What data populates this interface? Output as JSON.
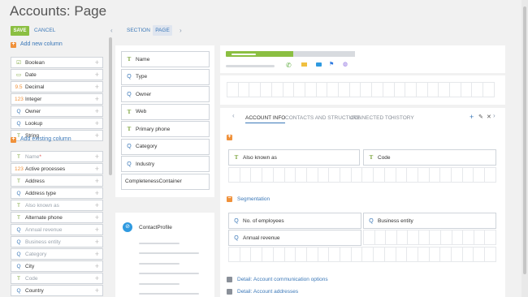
{
  "page": {
    "title": "Accounts: Page"
  },
  "toolbar": {
    "save_label": "SAVE",
    "cancel_label": "CANCEL"
  },
  "designer_tabs": {
    "section_label": "SECTION",
    "page_label": "PAGE"
  },
  "left": {
    "add_new_column_label": "Add new column",
    "new_columns": [
      {
        "icon": "☑",
        "label": "Boolean"
      },
      {
        "icon": "▭",
        "label": "Date"
      },
      {
        "icon": "9.5",
        "label": "Decimal"
      },
      {
        "icon": "123",
        "label": "Integer"
      },
      {
        "icon": "Q",
        "label": "Owner"
      },
      {
        "icon": "Q",
        "label": "Lookup"
      },
      {
        "icon": "T",
        "label": "String"
      }
    ],
    "add_existing_column_label": "Add existing column",
    "existing_columns": [
      {
        "icon": "T",
        "label": "Name",
        "required": "*"
      },
      {
        "icon": "123",
        "label": "Active processes"
      },
      {
        "icon": "T",
        "label": "Address"
      },
      {
        "icon": "Q",
        "label": "Address type"
      },
      {
        "icon": "T",
        "label": "Also known as"
      },
      {
        "icon": "T",
        "label": "Alternate phone"
      },
      {
        "icon": "Q",
        "label": "Annual revenue"
      },
      {
        "icon": "Q",
        "label": "Business entity"
      },
      {
        "icon": "Q",
        "label": "Category"
      },
      {
        "icon": "Q",
        "label": "City"
      },
      {
        "icon": "T",
        "label": "Code"
      },
      {
        "icon": "Q",
        "label": "Country"
      }
    ]
  },
  "profile_fields": [
    {
      "icon": "T",
      "label": "Name"
    },
    {
      "icon": "Q",
      "label": "Type"
    },
    {
      "icon": "Q",
      "label": "Owner"
    },
    {
      "icon": "T",
      "label": "Web"
    },
    {
      "icon": "T",
      "label": "Primary phone"
    },
    {
      "icon": "Q",
      "label": "Category"
    },
    {
      "icon": "Q",
      "label": "Industry"
    },
    {
      "icon": "",
      "label": "CompletenessContainer"
    }
  ],
  "contact_profile": {
    "label": "ContactProfile"
  },
  "detail_tabs": [
    "ACCOUNT INFO",
    "CONTACTS AND STRUCTURE",
    "CONNECTED TO",
    "HISTORY"
  ],
  "account_info": {
    "row1": [
      {
        "icon": "T",
        "label": "Also known as"
      },
      {
        "icon": "T",
        "label": "Code"
      }
    ],
    "segmentation_label": "Segmentation",
    "seg_row1": [
      {
        "icon": "Q",
        "label": "No. of employees"
      },
      {
        "icon": "Q",
        "label": "Business entity"
      }
    ],
    "seg_row2": [
      {
        "icon": "Q",
        "label": "Annual revenue"
      }
    ],
    "detail_communication": "Detail: Account communication options",
    "detail_addresses": "Detail: Account addresses"
  },
  "colors": {
    "accent": "#3b78b8",
    "save": "#8bbf42",
    "orange": "#f0913a",
    "green": "#7aa33a"
  }
}
